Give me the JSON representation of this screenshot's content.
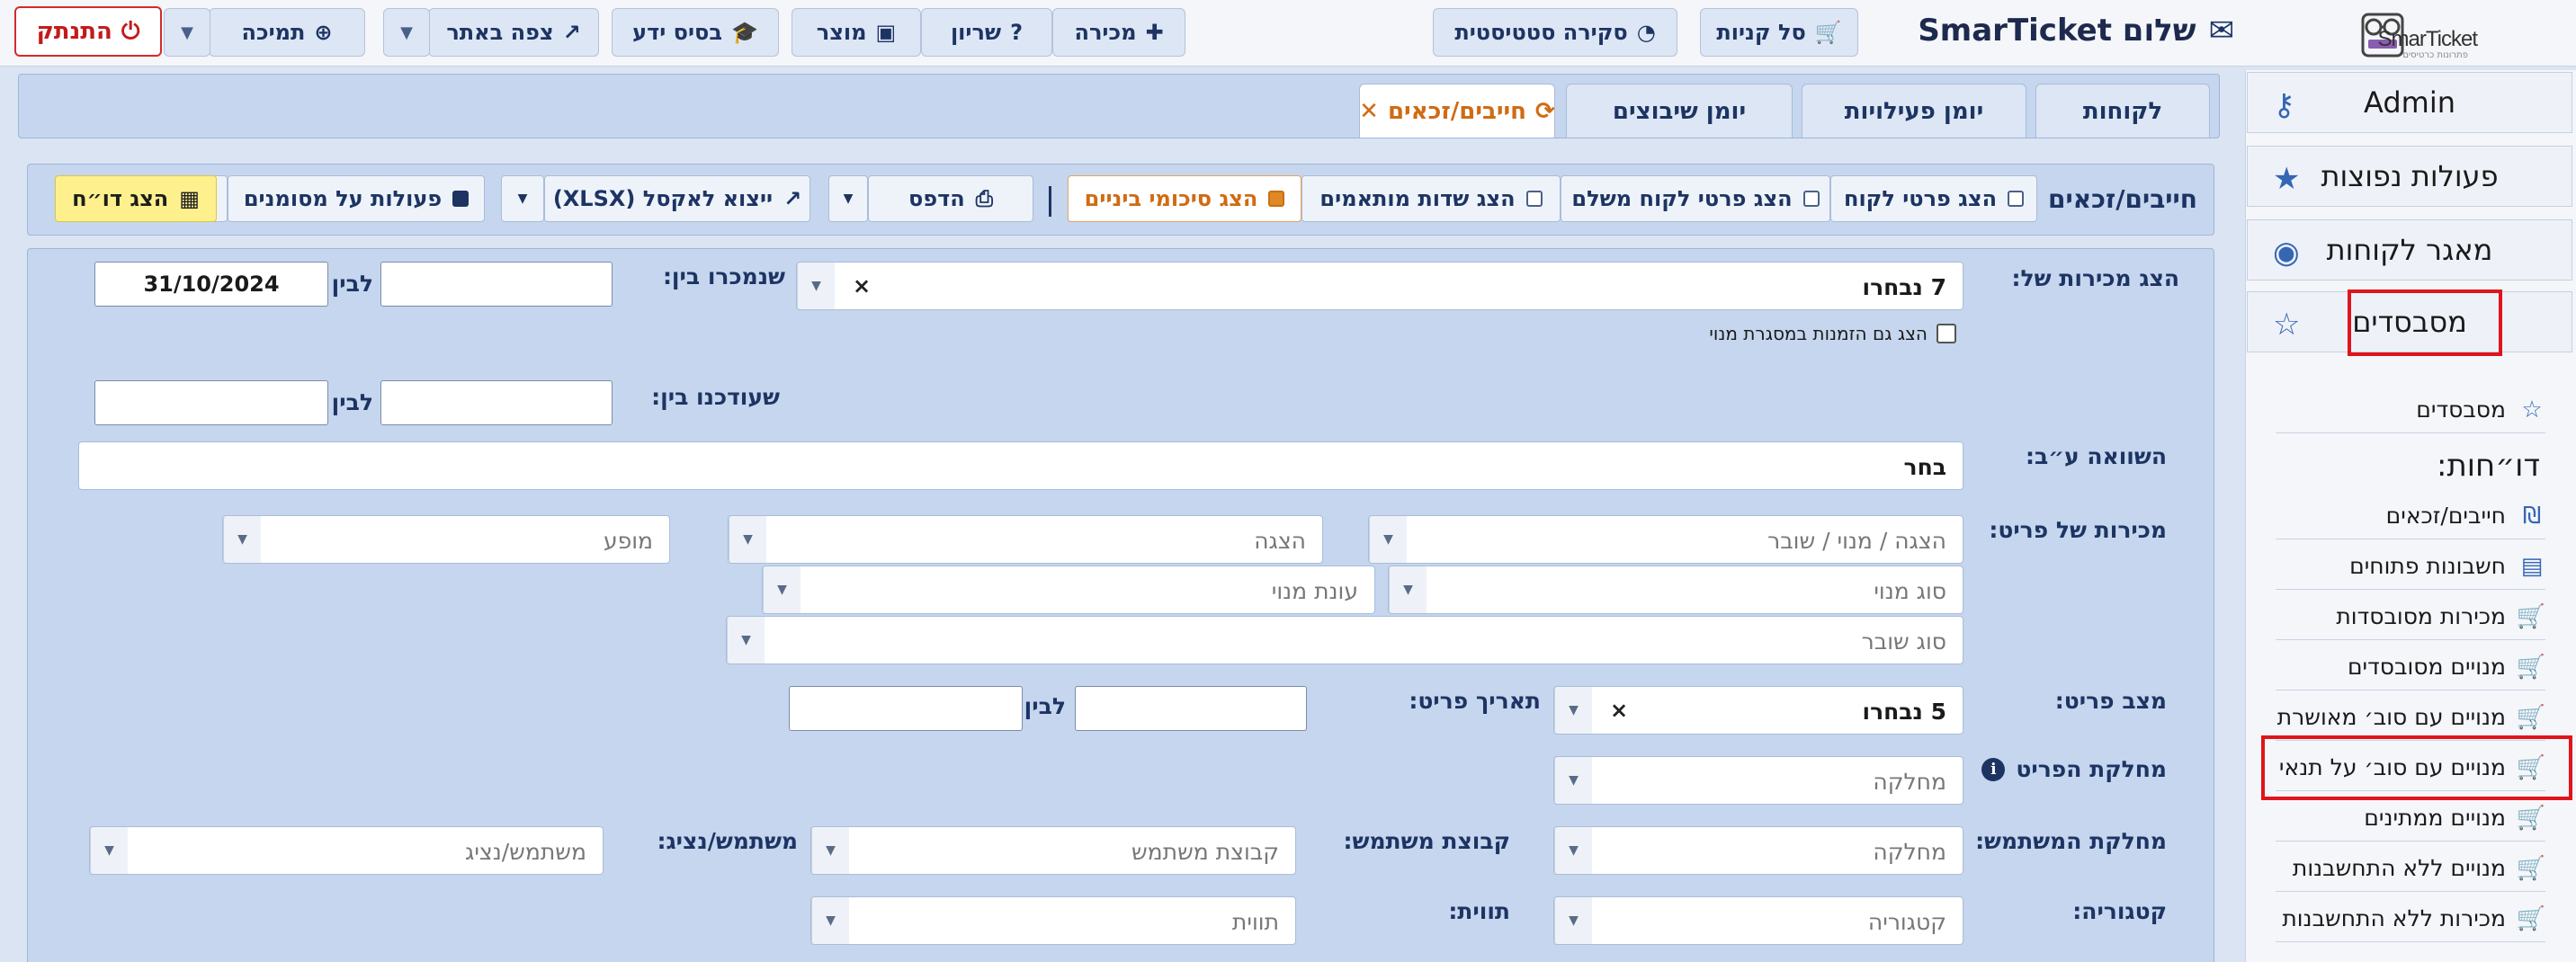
{
  "brand": {
    "logo_text": "SmarTicket",
    "logo_sub": "פתרונות כרטיסים"
  },
  "header": {
    "greeting": "שלום SmarTicket",
    "cart": "סל קניות",
    "stats": "סקירה סטטיסטית",
    "sale": "מכירה",
    "reserve": "שריון",
    "product": "מוצר",
    "knowledge": "בסיס ידע",
    "view_site": "צפה באתר",
    "support": "תמיכה",
    "logout": "התנתק"
  },
  "sidebar": {
    "main": [
      {
        "label": "Admin",
        "icon": "key-icon"
      },
      {
        "label": "פעולות נפוצות",
        "icon": "star-icon"
      },
      {
        "label": "מאגר לקוחות",
        "icon": "user-circle-icon"
      },
      {
        "label": "מסבסדים",
        "icon": "star-outline-icon"
      }
    ],
    "subsidizers_link": "מסבסדים",
    "reports_title": "דו״חות:",
    "reports": [
      "חייבים/זכאים",
      "חשבונות פתוחים",
      "מכירות מסובסדות",
      "מנויים מסובסדים",
      "מנויים עם סוב׳ מאושרת",
      "מנויים עם סוב׳ על תנאי",
      "מנויים ממתינים",
      "מנויים ללא התחשבנות",
      "מכירות ללא התחשבנות"
    ]
  },
  "tabs": [
    "לקוחות",
    "יומן פעילויות",
    "יומן שיבוצים",
    "חייבים/זכאים"
  ],
  "toolbar": {
    "title": "חייבים/זכאים",
    "show_customer": "הצג פרטי לקוח",
    "show_payer": "הצג פרטי לקוח משלם",
    "show_custom": "הצג שדות מותאמים",
    "show_subtotals": "הצג סיכומי ביניים",
    "print": "הדפס",
    "export": "ייצוא לאקסל (XLSX)",
    "marked_actions": "פעולות על מסומנים",
    "show_report": "הצג דו״ח"
  },
  "form": {
    "sales_of_label": "הצג מכירות של:",
    "sales_of_value": "7 נבחרו",
    "include_subs": "הצג גם הזמנות במסגרת מנוי",
    "sold_between": "שנמכרו בין:",
    "updated_between": "שעודכנו בין:",
    "to": "לבין",
    "to_date": "31/10/2024",
    "compare_label": "השוואה ע״ב:",
    "compare_value": "בחר",
    "item_sales_label": "מכירות של פריט:",
    "ph_show_sub": "הצגה / מנוי / שובר",
    "ph_show": "הצגה",
    "ph_performance": "מופע",
    "ph_sub_type": "סוג מנוי",
    "ph_season": "עונת מנוי",
    "ph_voucher": "סוג שובר",
    "item_state_label": "מצב פריט:",
    "item_state_value": "5 נבחרו",
    "item_date_label": "תאריך פריט:",
    "item_dept_label": "מחלקת הפריט",
    "ph_dept": "מחלקה",
    "user_dept_label": "מחלקת המשתמש:",
    "user_group_label": "קבוצת משתמש:",
    "ph_user_group": "קבוצת משתמש",
    "user_label": "משתמש/נציג:",
    "ph_user": "משתמש/נציג",
    "category_label": "קטגוריה:",
    "ph_category": "קטגוריה",
    "tags_label": "תווית:",
    "ph_tags": "תווית"
  },
  "colors": {
    "accent_orange": "#d06b13",
    "navy": "#1d3463",
    "highlight_red": "#e0141b",
    "yellow_btn": "#fdf08d"
  }
}
